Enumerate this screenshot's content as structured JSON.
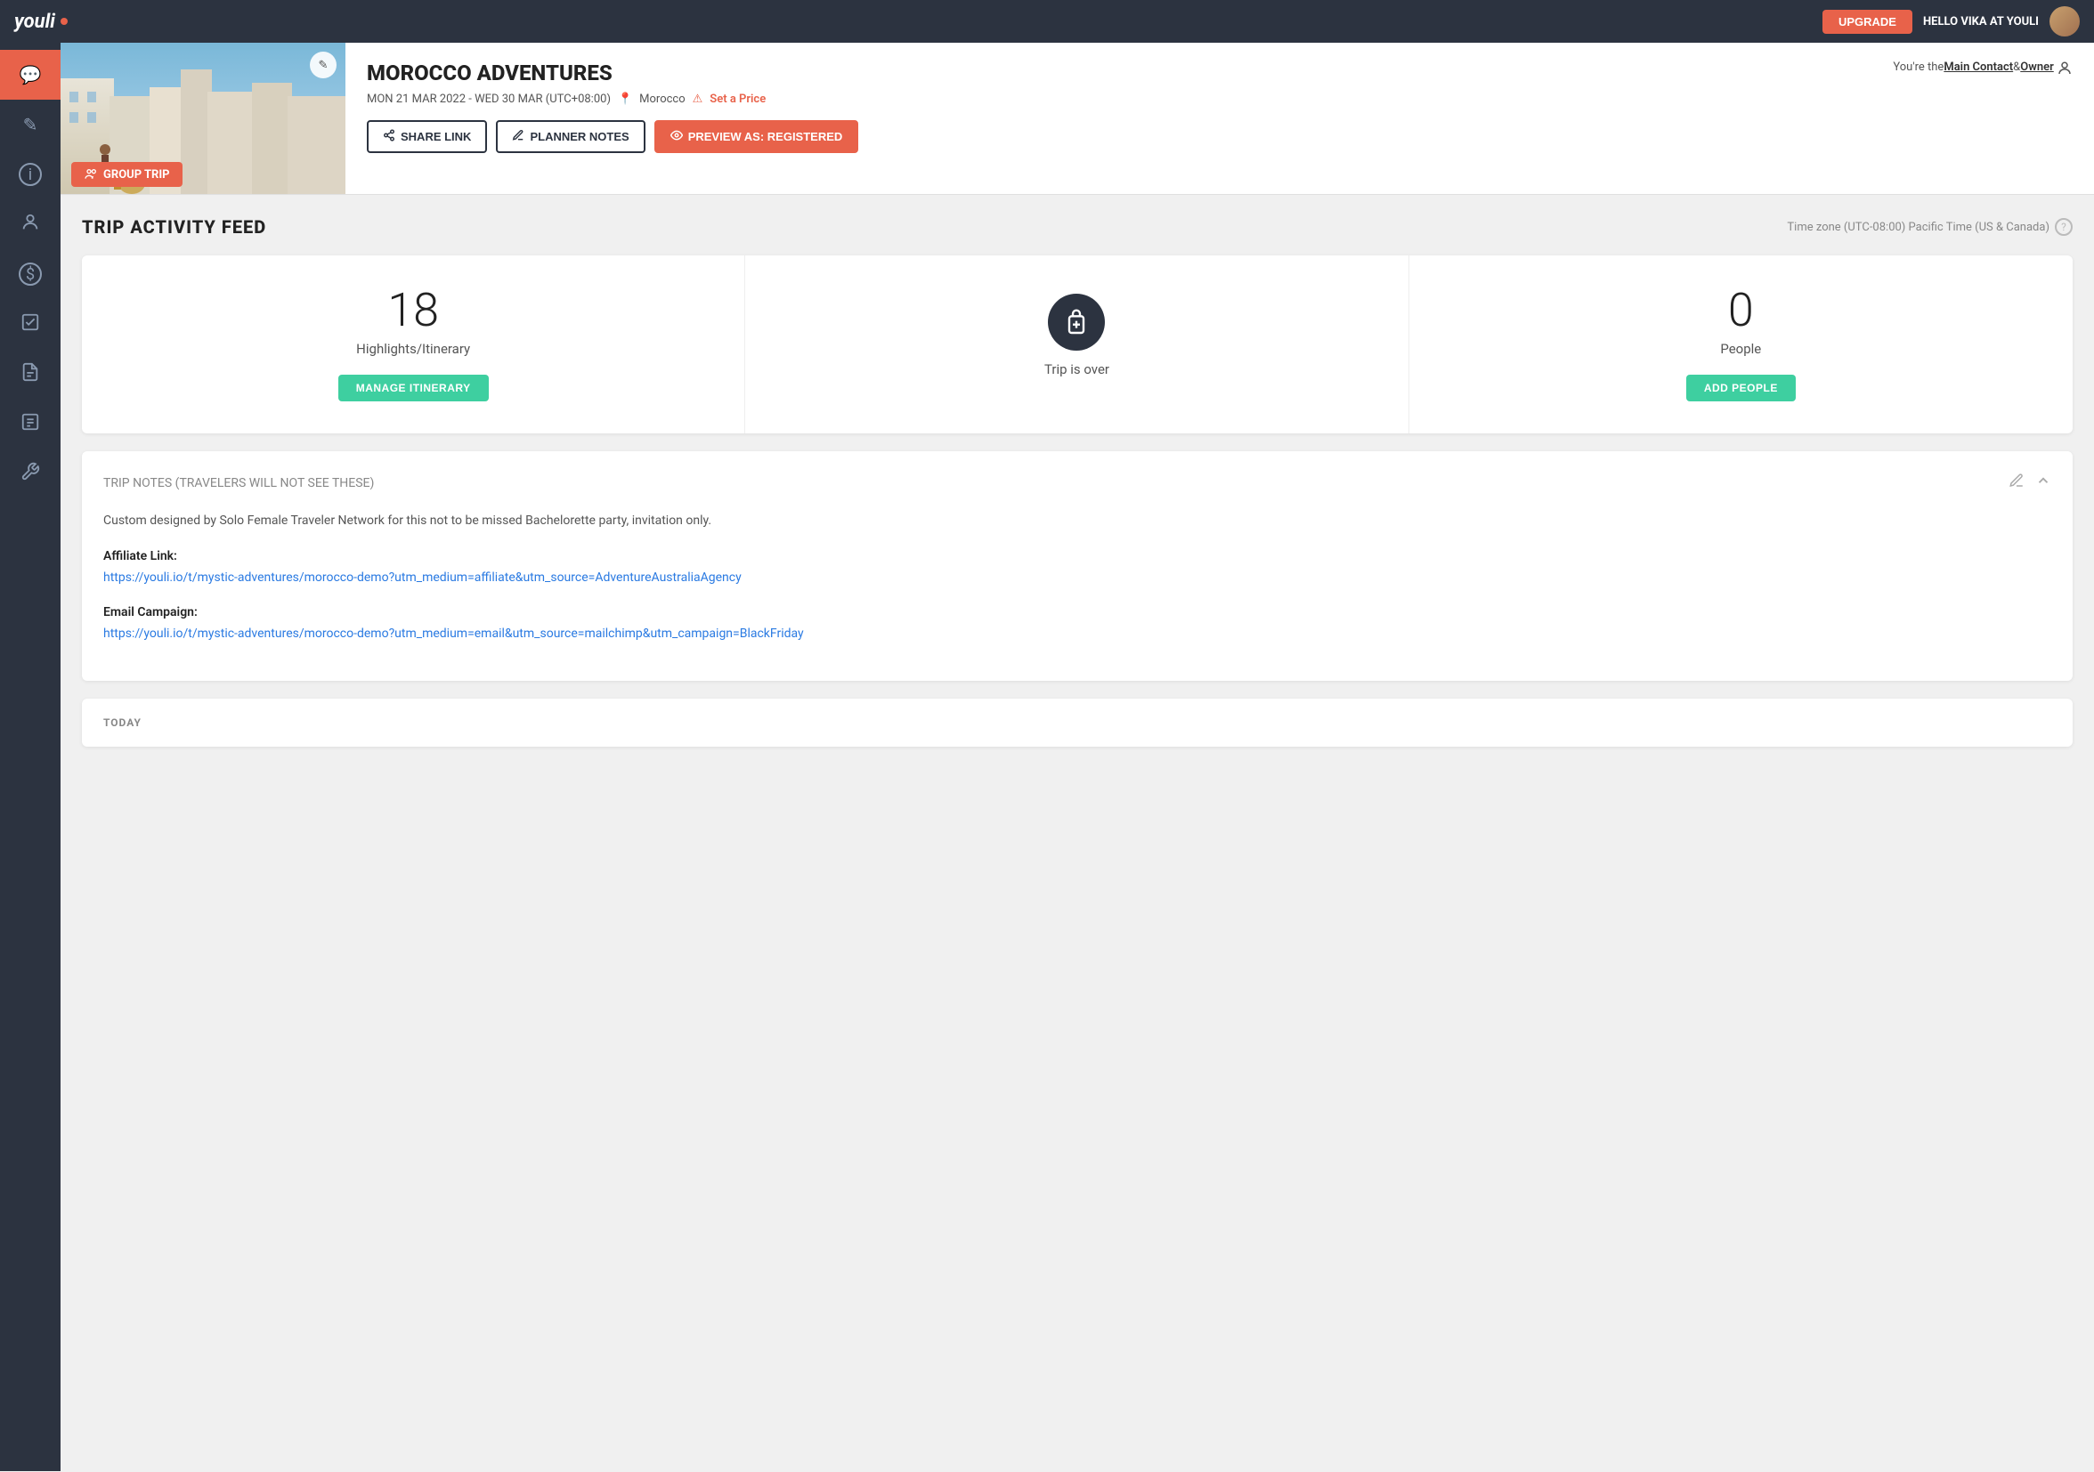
{
  "topNav": {
    "logoText": "youli",
    "upgradeLabel": "UPGRADE",
    "helloPrefix": "HELLO ",
    "username": "VIKA AT YOULI"
  },
  "tripHeader": {
    "title": "MOROCCO ADVENTURES",
    "dates": "MON 21 MAR 2022 - WED 30 MAR (UTC+08:00)",
    "location": "Morocco",
    "priceLink": "Set a Price",
    "editIcon": "✎",
    "groupTripLabel": "GROUP TRIP",
    "rolePrefixText": "You're the ",
    "mainContactLabel": "Main Contact",
    "ampersand": " & ",
    "ownerLabel": "Owner",
    "actions": {
      "shareLink": "SHARE LINK",
      "plannerNotes": "PLANNER NOTES",
      "previewAs": "PREVIEW AS: REGISTERED"
    }
  },
  "activityFeed": {
    "title": "TRIP ACTIVITY FEED",
    "timezone": "Time zone (UTC-08:00) Pacific Time (US & Canada)"
  },
  "stats": {
    "highlights": {
      "number": "18",
      "label": "Highlights/Itinerary",
      "btnLabel": "MANAGE ITINERARY"
    },
    "tripStatus": {
      "label": "Trip is over"
    },
    "people": {
      "number": "0",
      "label": "People",
      "btnLabel": "ADD PEOPLE"
    }
  },
  "tripNotes": {
    "title": "TRIP NOTES",
    "subtitle": "(travelers will not see these)",
    "body": "Custom designed by Solo Female Traveler Network for this not to be missed Bachelorette party, invitation only.",
    "affiliateLabel": "Affiliate Link:",
    "affiliateLink": "https://youli.io/t/mystic-adventures/morocco-demo?utm_medium=affiliate&utm_source=AdventureAustraliaAgency",
    "emailLabel": "Email Campaign:",
    "emailLink": "https://youli.io/t/mystic-adventures/morocco-demo?utm_medium=email&utm_source=mailchimp&utm_campaign=BlackFriday"
  },
  "today": {
    "label": "TODAY"
  },
  "sidebar": {
    "items": [
      {
        "id": "activity-feed",
        "icon": "💬",
        "active": true
      },
      {
        "id": "edit",
        "icon": "✎",
        "active": false
      },
      {
        "id": "info",
        "icon": "ⓘ",
        "active": false
      },
      {
        "id": "people",
        "icon": "◉",
        "active": false
      },
      {
        "id": "dollar",
        "icon": "$",
        "active": false
      },
      {
        "id": "checklist",
        "icon": "☑",
        "active": false
      },
      {
        "id": "docs",
        "icon": "☰",
        "active": false
      },
      {
        "id": "reports",
        "icon": "≡",
        "active": false
      },
      {
        "id": "settings",
        "icon": "⚙",
        "active": false
      }
    ]
  }
}
